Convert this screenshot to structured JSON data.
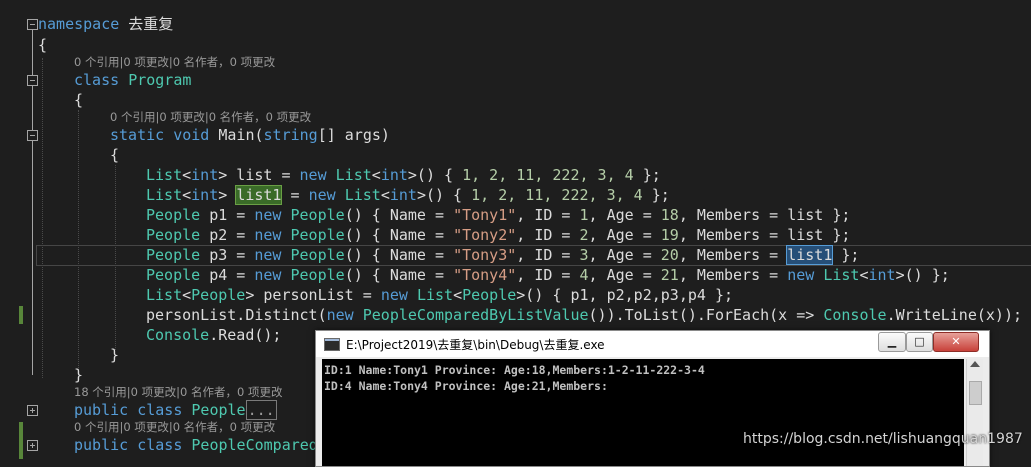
{
  "editor": {
    "l1": {
      "kw": "namespace",
      "rest": " 去重复"
    },
    "l2": "{",
    "lens1": "0 个引用|0 项更改|0 名作者，0 项更改",
    "l3": {
      "kw": "class",
      "ty": "Program"
    },
    "l4": "{",
    "lens2": "0 个引用|0 项更改|0 名作者，0 项更改",
    "l5": {
      "kw1": "static",
      "kw2": "void",
      "name": " Main(",
      "kw3": "string",
      "rest": "[] args)"
    },
    "l6": "{",
    "code1": {
      "a": "List",
      "b": "<",
      "c": "int",
      "d": "> list = ",
      "e": "new",
      "f": " ",
      "g": "List",
      "h": "<",
      "i": "int",
      "j": ">() { ",
      "k": "1, 2, 11, 222, 3, 4",
      "l": " };"
    },
    "code2": {
      "a": "List",
      "b": "<",
      "c": "int",
      "d": "> ",
      "hl": "list1",
      "e": " = ",
      "f": "new",
      "g": " ",
      "h": "List",
      "i": "<",
      "j": "int",
      "k": ">() { ",
      "l": "1, 2, 11, 222, 3, 4",
      "m": " };"
    },
    "code3": {
      "t": "People",
      "v": " p1 = ",
      "n": "new",
      "t2": "People",
      "r1": "() { Name = ",
      "s": "\"Tony1\"",
      "r2": ", ID = ",
      "n1": "1",
      "r3": ", Age = ",
      "n2": "18",
      "r4": ", Members = list };"
    },
    "code4": {
      "t": "People",
      "v": " p2 = ",
      "n": "new",
      "t2": "People",
      "r1": "() { Name = ",
      "s": "\"Tony2\"",
      "r2": ", ID = ",
      "n1": "2",
      "r3": ", Age = ",
      "n2": "19",
      "r4": ", Members = list };"
    },
    "code5": {
      "t": "People",
      "v": " p3 = ",
      "n": "new",
      "t2": "People",
      "r1": "() { Name = ",
      "s": "\"Tony3\"",
      "r2": ", ID = ",
      "n1": "3",
      "r3": ", Age = ",
      "n2": "20",
      "r4": ", Members = ",
      "hl": "list1",
      "r5": " };"
    },
    "code6": {
      "t": "People",
      "v": " p4 = ",
      "n": "new",
      "t2": "People",
      "r1": "() { Name = ",
      "s": "\"Tony4\"",
      "r2": ", ID = ",
      "n1": "4",
      "r3": ", Age = ",
      "n2": "21",
      "r4": ", Members = ",
      "n3": "new",
      "t3": "List",
      "r5": "<",
      "kw": "int",
      "r6": ">() };"
    },
    "code7": {
      "t": "List",
      "a": "<",
      "t2": "People",
      "b": "> personList = ",
      "n": "new",
      "t3": "List",
      "c": "<",
      "t4": "People",
      "d": ">() { p1, p2,p2,p3,p4 };"
    },
    "code8": {
      "a": "personList.Distinct(",
      "n": "new",
      "t": " PeopleComparedByListValue",
      "b": "()).ToList().ForEach(x => ",
      "t2": "Console",
      "c": ".WriteLine(x));"
    },
    "code9": {
      "t": "Console",
      "a": ".Read();"
    },
    "l7": "}",
    "l8": "}",
    "lens3": "18 个引用|0 项更改|0 名作者，0 项更改",
    "l9": {
      "kw1": "public",
      "kw2": "class",
      "ty": "People",
      "ell": "..."
    },
    "lens4": "0 个引用|0 项更改|0 名作者，0 项更改",
    "l10": {
      "kw1": "public",
      "kw2": "class",
      "ty": "PeopleCompared"
    }
  },
  "console": {
    "title": "E:\\Project2019\\去重复\\bin\\Debug\\去重复.exe",
    "min_label": "▁",
    "max_label": "□",
    "close_label": "✕",
    "output": [
      "ID:1 Name:Tony1 Province: Age:18,Members:1-2-11-222-3-4",
      "ID:4 Name:Tony4 Province: Age:21,Members:"
    ]
  },
  "watermark": "https://blog.csdn.net/lishuangquan1987"
}
